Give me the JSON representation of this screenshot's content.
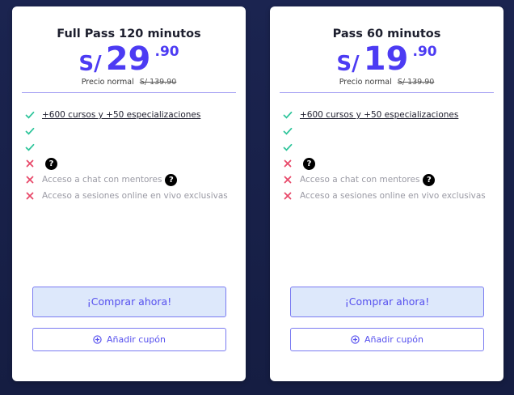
{
  "plans": [
    {
      "title": "Full Pass 120 minutos",
      "currency": "S/",
      "price_int": "29",
      "price_dec": ".90",
      "normal_label": "Precio normal",
      "normal_price": "S/ 139.90",
      "features": [
        {
          "status": "check-icon",
          "label": "+600 cursos y +50 especializaciones",
          "help": false
        },
        {
          "status": "check-icon",
          "label": "",
          "help": false
        },
        {
          "status": "check-icon",
          "label": "",
          "help": false
        },
        {
          "status": "cross-icon",
          "label": "",
          "help": true
        },
        {
          "status": "cross-icon",
          "label": "Acceso a chat con mentores",
          "help": true
        },
        {
          "status": "cross-icon",
          "label": "Acceso a sesiones online en vivo exclusivas",
          "help": false
        }
      ],
      "buy_label": "¡Comprar ahora!",
      "coupon_label": "Añadir cupón"
    },
    {
      "title": "Pass 60 minutos",
      "currency": "S/",
      "price_int": "19",
      "price_dec": ".90",
      "normal_label": "Precio normal",
      "normal_price": "S/ 139.90",
      "features": [
        {
          "status": "check-icon",
          "label": "+600 cursos y +50 especializaciones",
          "help": false
        },
        {
          "status": "check-icon",
          "label": "",
          "help": false
        },
        {
          "status": "check-icon",
          "label": "",
          "help": false
        },
        {
          "status": "cross-icon",
          "label": "",
          "help": true
        },
        {
          "status": "cross-icon",
          "label": "Acceso a chat con mentores",
          "help": true
        },
        {
          "status": "cross-icon",
          "label": "Acceso a sesiones online en vivo exclusivas",
          "help": false
        }
      ],
      "buy_label": "¡Comprar ahora!",
      "coupon_label": "Añadir cupón"
    }
  ],
  "help_glyph": "?",
  "colors": {
    "accent": "#4c3bf3",
    "check": "#2fc59b",
    "cross": "#e8496a",
    "buy_bg": "#dde8fb",
    "background": "#1b2450"
  }
}
